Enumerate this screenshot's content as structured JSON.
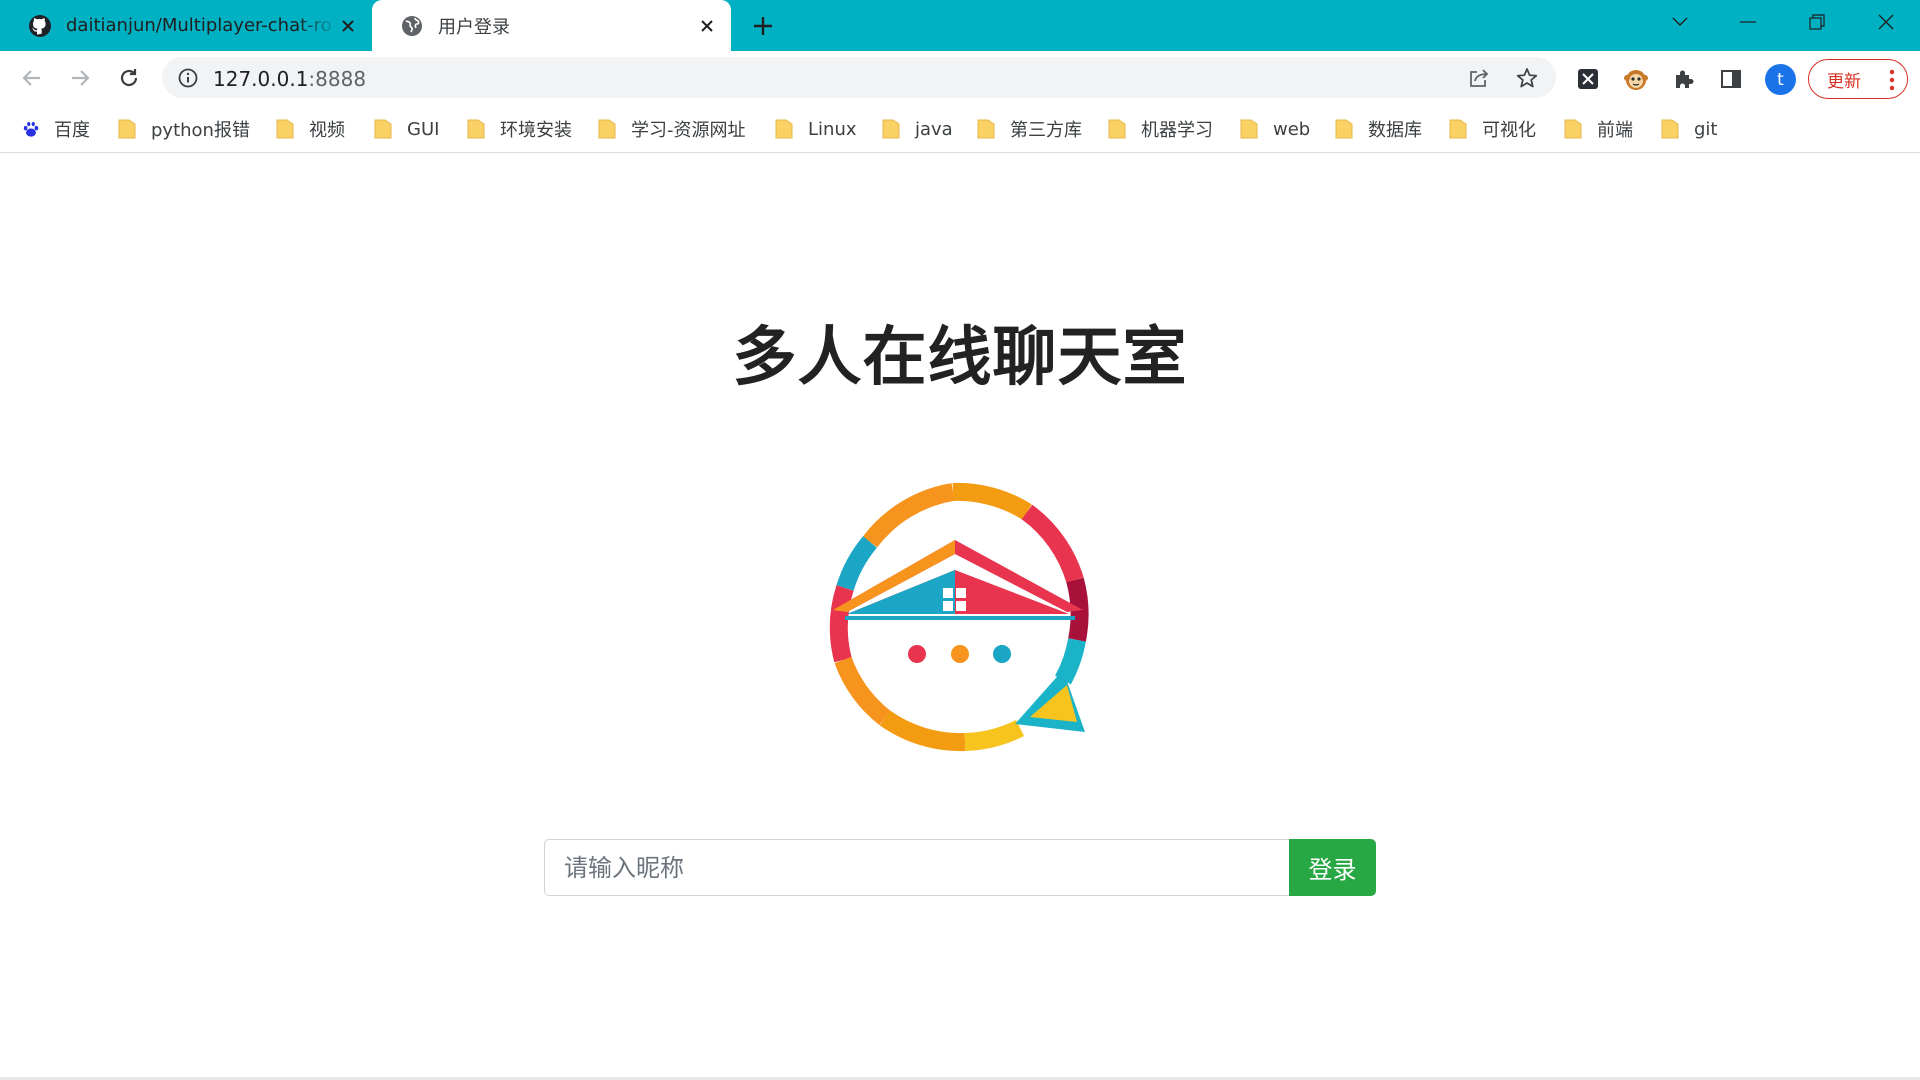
{
  "tabs": [
    {
      "title": "daitianjun/Multiplayer-chat-ro",
      "favicon": "github-icon",
      "active": false
    },
    {
      "title": "用户登录",
      "favicon": "globe-icon",
      "active": true
    }
  ],
  "address_bar": {
    "host": "127.0.0.1",
    "port": ":8888"
  },
  "toolbar": {
    "update_label": "更新",
    "profile_initial": "t"
  },
  "bookmarks": [
    "百度",
    "python报错",
    "视频",
    "GUI",
    "环境安装",
    "学习-资源网址",
    "Linux",
    "java",
    "第三方库",
    "机器学习",
    "web",
    "数据库",
    "可视化",
    "前端",
    "git"
  ],
  "page": {
    "title": "多人在线聊天室",
    "nickname_placeholder": "请输入昵称",
    "nickname_value": "",
    "login_label": "登录"
  },
  "colors": {
    "tab_strip": "#00b1c4",
    "login_button": "#28a745",
    "update_button": "#d93025"
  }
}
